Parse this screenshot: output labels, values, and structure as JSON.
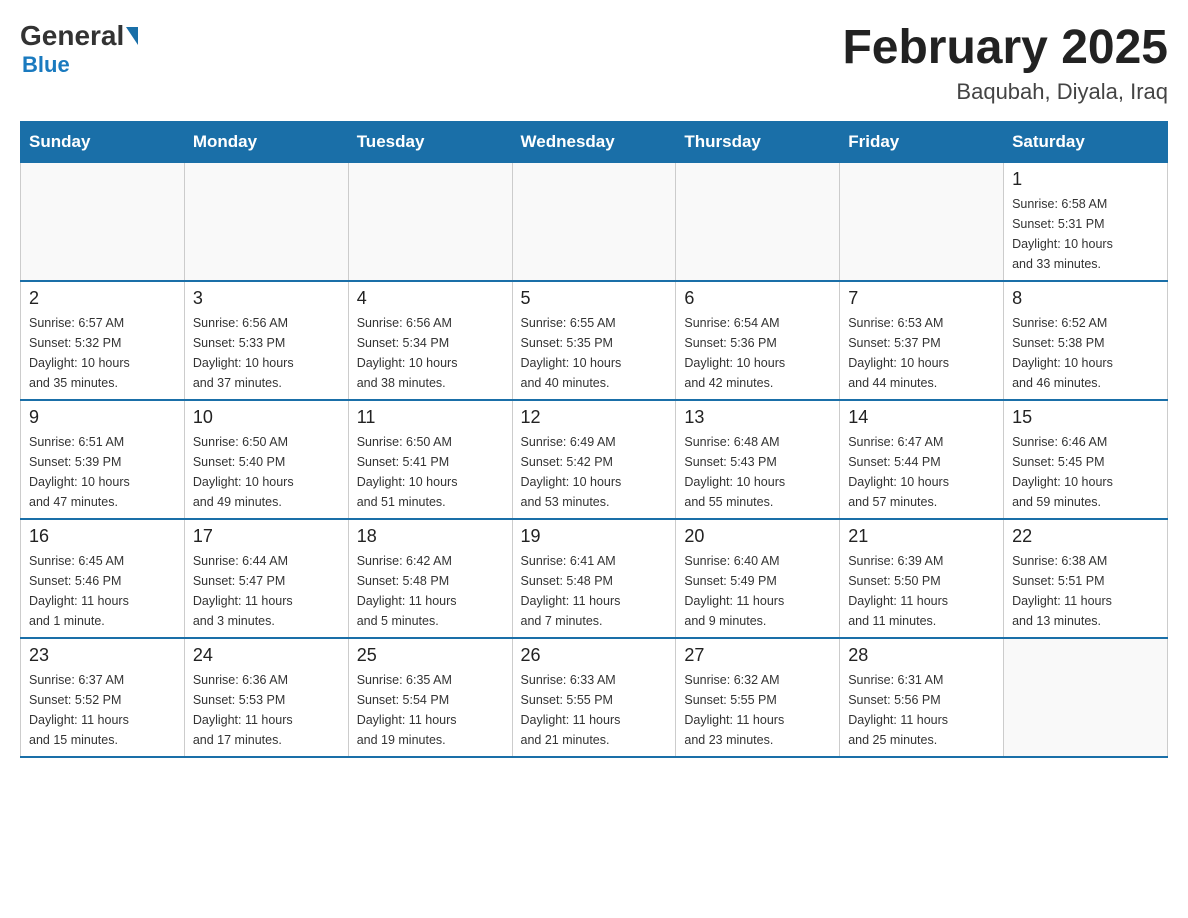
{
  "header": {
    "logo_general": "General",
    "logo_blue": "Blue",
    "month_title": "February 2025",
    "location": "Baqubah, Diyala, Iraq"
  },
  "weekdays": [
    "Sunday",
    "Monday",
    "Tuesday",
    "Wednesday",
    "Thursday",
    "Friday",
    "Saturday"
  ],
  "weeks": [
    [
      {
        "day": "",
        "info": ""
      },
      {
        "day": "",
        "info": ""
      },
      {
        "day": "",
        "info": ""
      },
      {
        "day": "",
        "info": ""
      },
      {
        "day": "",
        "info": ""
      },
      {
        "day": "",
        "info": ""
      },
      {
        "day": "1",
        "info": "Sunrise: 6:58 AM\nSunset: 5:31 PM\nDaylight: 10 hours\nand 33 minutes."
      }
    ],
    [
      {
        "day": "2",
        "info": "Sunrise: 6:57 AM\nSunset: 5:32 PM\nDaylight: 10 hours\nand 35 minutes."
      },
      {
        "day": "3",
        "info": "Sunrise: 6:56 AM\nSunset: 5:33 PM\nDaylight: 10 hours\nand 37 minutes."
      },
      {
        "day": "4",
        "info": "Sunrise: 6:56 AM\nSunset: 5:34 PM\nDaylight: 10 hours\nand 38 minutes."
      },
      {
        "day": "5",
        "info": "Sunrise: 6:55 AM\nSunset: 5:35 PM\nDaylight: 10 hours\nand 40 minutes."
      },
      {
        "day": "6",
        "info": "Sunrise: 6:54 AM\nSunset: 5:36 PM\nDaylight: 10 hours\nand 42 minutes."
      },
      {
        "day": "7",
        "info": "Sunrise: 6:53 AM\nSunset: 5:37 PM\nDaylight: 10 hours\nand 44 minutes."
      },
      {
        "day": "8",
        "info": "Sunrise: 6:52 AM\nSunset: 5:38 PM\nDaylight: 10 hours\nand 46 minutes."
      }
    ],
    [
      {
        "day": "9",
        "info": "Sunrise: 6:51 AM\nSunset: 5:39 PM\nDaylight: 10 hours\nand 47 minutes."
      },
      {
        "day": "10",
        "info": "Sunrise: 6:50 AM\nSunset: 5:40 PM\nDaylight: 10 hours\nand 49 minutes."
      },
      {
        "day": "11",
        "info": "Sunrise: 6:50 AM\nSunset: 5:41 PM\nDaylight: 10 hours\nand 51 minutes."
      },
      {
        "day": "12",
        "info": "Sunrise: 6:49 AM\nSunset: 5:42 PM\nDaylight: 10 hours\nand 53 minutes."
      },
      {
        "day": "13",
        "info": "Sunrise: 6:48 AM\nSunset: 5:43 PM\nDaylight: 10 hours\nand 55 minutes."
      },
      {
        "day": "14",
        "info": "Sunrise: 6:47 AM\nSunset: 5:44 PM\nDaylight: 10 hours\nand 57 minutes."
      },
      {
        "day": "15",
        "info": "Sunrise: 6:46 AM\nSunset: 5:45 PM\nDaylight: 10 hours\nand 59 minutes."
      }
    ],
    [
      {
        "day": "16",
        "info": "Sunrise: 6:45 AM\nSunset: 5:46 PM\nDaylight: 11 hours\nand 1 minute."
      },
      {
        "day": "17",
        "info": "Sunrise: 6:44 AM\nSunset: 5:47 PM\nDaylight: 11 hours\nand 3 minutes."
      },
      {
        "day": "18",
        "info": "Sunrise: 6:42 AM\nSunset: 5:48 PM\nDaylight: 11 hours\nand 5 minutes."
      },
      {
        "day": "19",
        "info": "Sunrise: 6:41 AM\nSunset: 5:48 PM\nDaylight: 11 hours\nand 7 minutes."
      },
      {
        "day": "20",
        "info": "Sunrise: 6:40 AM\nSunset: 5:49 PM\nDaylight: 11 hours\nand 9 minutes."
      },
      {
        "day": "21",
        "info": "Sunrise: 6:39 AM\nSunset: 5:50 PM\nDaylight: 11 hours\nand 11 minutes."
      },
      {
        "day": "22",
        "info": "Sunrise: 6:38 AM\nSunset: 5:51 PM\nDaylight: 11 hours\nand 13 minutes."
      }
    ],
    [
      {
        "day": "23",
        "info": "Sunrise: 6:37 AM\nSunset: 5:52 PM\nDaylight: 11 hours\nand 15 minutes."
      },
      {
        "day": "24",
        "info": "Sunrise: 6:36 AM\nSunset: 5:53 PM\nDaylight: 11 hours\nand 17 minutes."
      },
      {
        "day": "25",
        "info": "Sunrise: 6:35 AM\nSunset: 5:54 PM\nDaylight: 11 hours\nand 19 minutes."
      },
      {
        "day": "26",
        "info": "Sunrise: 6:33 AM\nSunset: 5:55 PM\nDaylight: 11 hours\nand 21 minutes."
      },
      {
        "day": "27",
        "info": "Sunrise: 6:32 AM\nSunset: 5:55 PM\nDaylight: 11 hours\nand 23 minutes."
      },
      {
        "day": "28",
        "info": "Sunrise: 6:31 AM\nSunset: 5:56 PM\nDaylight: 11 hours\nand 25 minutes."
      },
      {
        "day": "",
        "info": ""
      }
    ]
  ]
}
